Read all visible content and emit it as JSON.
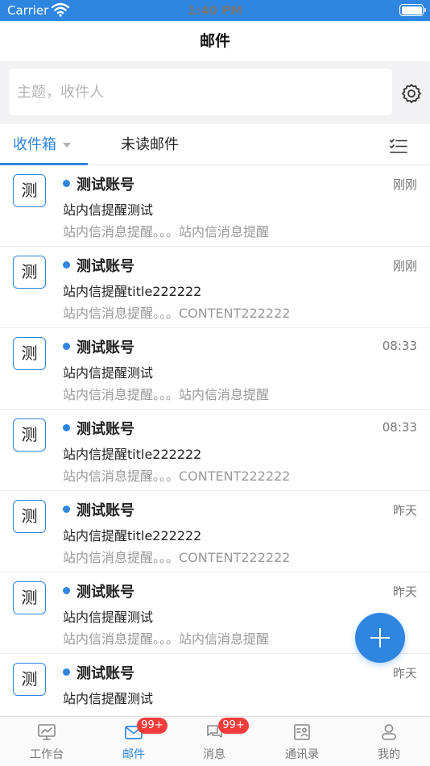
{
  "status_bar": {
    "carrier": "Carrier",
    "time": "1:40 PM"
  },
  "nav": {
    "title": "邮件"
  },
  "search": {
    "placeholder": "主题，收件人",
    "value": ""
  },
  "tabs": {
    "inbox": "收件箱",
    "unread": "未读邮件"
  },
  "messages": [
    {
      "avatar": "测",
      "sender": "测试账号",
      "time": "刚刚",
      "subject": "站内信提醒测试",
      "preview": "站内信消息提醒。。。站内信消息提醒"
    },
    {
      "avatar": "测",
      "sender": "测试账号",
      "time": "刚刚",
      "subject": "站内信提醒title222222",
      "preview": "站内信消息提醒。。。CONTENT222222"
    },
    {
      "avatar": "测",
      "sender": "测试账号",
      "time": "08:33",
      "subject": "站内信提醒测试",
      "preview": "站内信消息提醒。。。站内信消息提醒"
    },
    {
      "avatar": "测",
      "sender": "测试账号",
      "time": "08:33",
      "subject": "站内信提醒title222222",
      "preview": "站内信消息提醒。。。CONTENT222222"
    },
    {
      "avatar": "测",
      "sender": "测试账号",
      "time": "昨天",
      "subject": "站内信提醒title222222",
      "preview": "站内信消息提醒。。。CONTENT222222"
    },
    {
      "avatar": "测",
      "sender": "测试账号",
      "time": "昨天",
      "subject": "站内信提醒测试",
      "preview": "站内信消息提醒。。。站内信消息提醒"
    },
    {
      "avatar": "测",
      "sender": "测试账号",
      "time": "昨天",
      "subject": "站内信提醒测试",
      "preview": ""
    }
  ],
  "tabbar": {
    "workbench": "工作台",
    "mail": "邮件",
    "mail_badge": "99+",
    "messages": "消息",
    "messages_badge": "99+",
    "contacts": "通讯录",
    "me": "我的"
  },
  "icons": {
    "wifi": "wifi-icon",
    "battery": "battery-icon",
    "settings": "gear-icon",
    "filter": "checklist-icon",
    "compose": "plus-icon",
    "workbench": "monitor-icon",
    "mail": "envelope-icon",
    "messages": "chat-icon",
    "contacts": "contact-card-icon",
    "me": "user-icon"
  },
  "colors": {
    "accent": "#2e86e0",
    "badge": "#f23c3c",
    "unread_dot": "#2e86e0"
  }
}
